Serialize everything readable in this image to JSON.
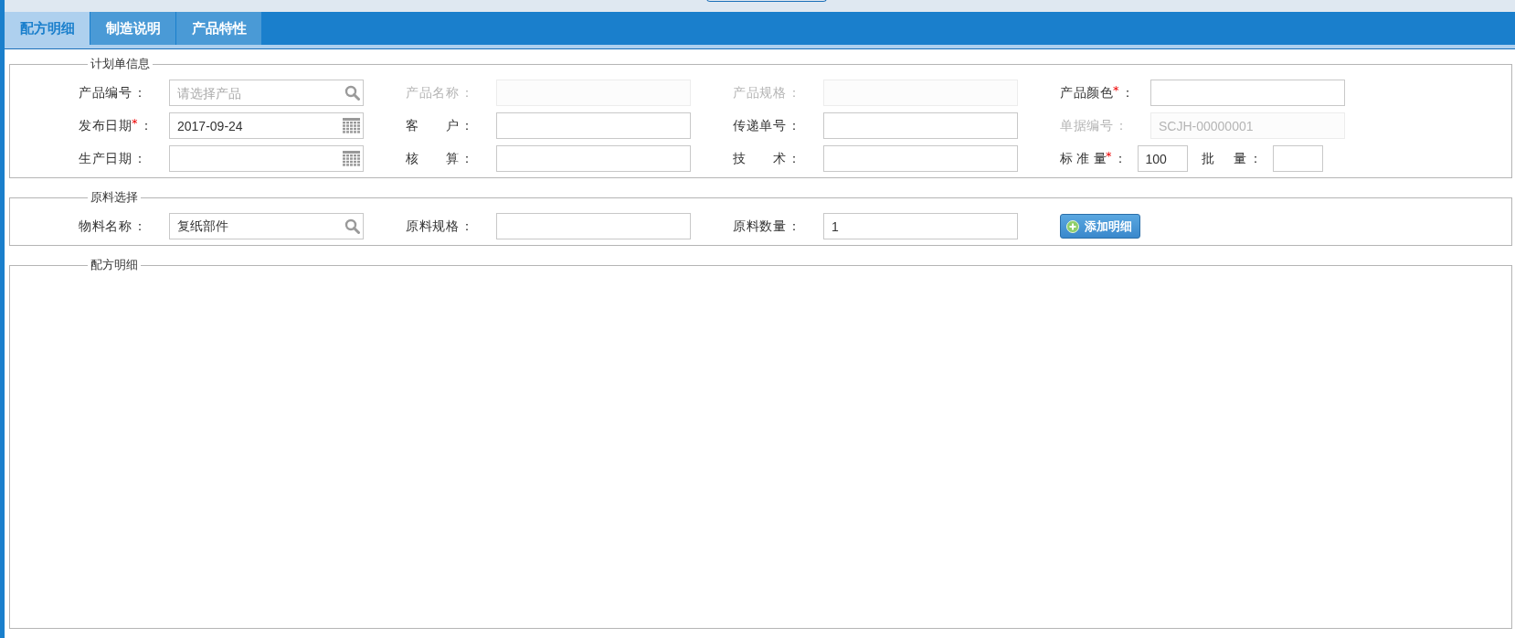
{
  "tabs": [
    {
      "label": "配方明细",
      "selected": true
    },
    {
      "label": "制造说明",
      "selected": false
    },
    {
      "label": "产品特性",
      "selected": false
    }
  ],
  "sections": [
    {
      "title": "计划单信息",
      "rows": [
        [
          {
            "kind": "lookup",
            "label": "产品编号",
            "colon": "：",
            "disabled": false,
            "placeholder": "请选择产品"
          },
          {
            "kind": "text",
            "label": "产品名称",
            "colon": "：",
            "disabled": true
          },
          {
            "kind": "text",
            "label": "产品规格",
            "colon": "：",
            "disabled": true
          },
          {
            "kind": "text",
            "label": "产品颜色",
            "required_mark": "*",
            "colon": "：",
            "disabled": false
          }
        ],
        [
          {
            "kind": "date",
            "label": "发布日期",
            "required_mark": "*",
            "colon": "：",
            "disabled": false,
            "value": "2017-09-24"
          },
          {
            "kind": "text",
            "label": "客 户",
            "colon": "：",
            "disabled": false
          },
          {
            "kind": "text",
            "label": "传递单号",
            "colon": "：",
            "disabled": false
          },
          {
            "kind": "text",
            "label": "单据编号",
            "colon": "：",
            "disabled": true,
            "value": "SCJH-00000001"
          }
        ],
        [
          {
            "kind": "date",
            "label": "生产日期",
            "colon": "：",
            "disabled": false
          },
          {
            "kind": "text",
            "label": "核 算",
            "colon": "：",
            "disabled": false
          },
          {
            "kind": "text",
            "label": "技 术",
            "colon": "：",
            "disabled": false
          },
          {
            "kind": "pair",
            "fields": [
              {
                "label": "标 准 量",
                "required_mark": "*",
                "colon": "：",
                "disabled": false,
                "value": "100"
              },
              {
                "label": "批 量",
                "colon": "：",
                "disabled": false
              }
            ]
          }
        ]
      ]
    },
    {
      "title": "原料选择",
      "rows": [
        [
          {
            "kind": "lookup",
            "label": "物料名称",
            "colon": "：",
            "disabled": false,
            "value": "复纸部件"
          },
          {
            "kind": "text",
            "label": "原料规格",
            "colon": "：",
            "disabled": false
          },
          {
            "kind": "text",
            "label": "原料数量",
            "colon": "：",
            "disabled": false,
            "value": "1"
          },
          {
            "kind": "button",
            "label": "添加明细"
          }
        ]
      ]
    },
    {
      "title": "配方明细"
    }
  ]
}
